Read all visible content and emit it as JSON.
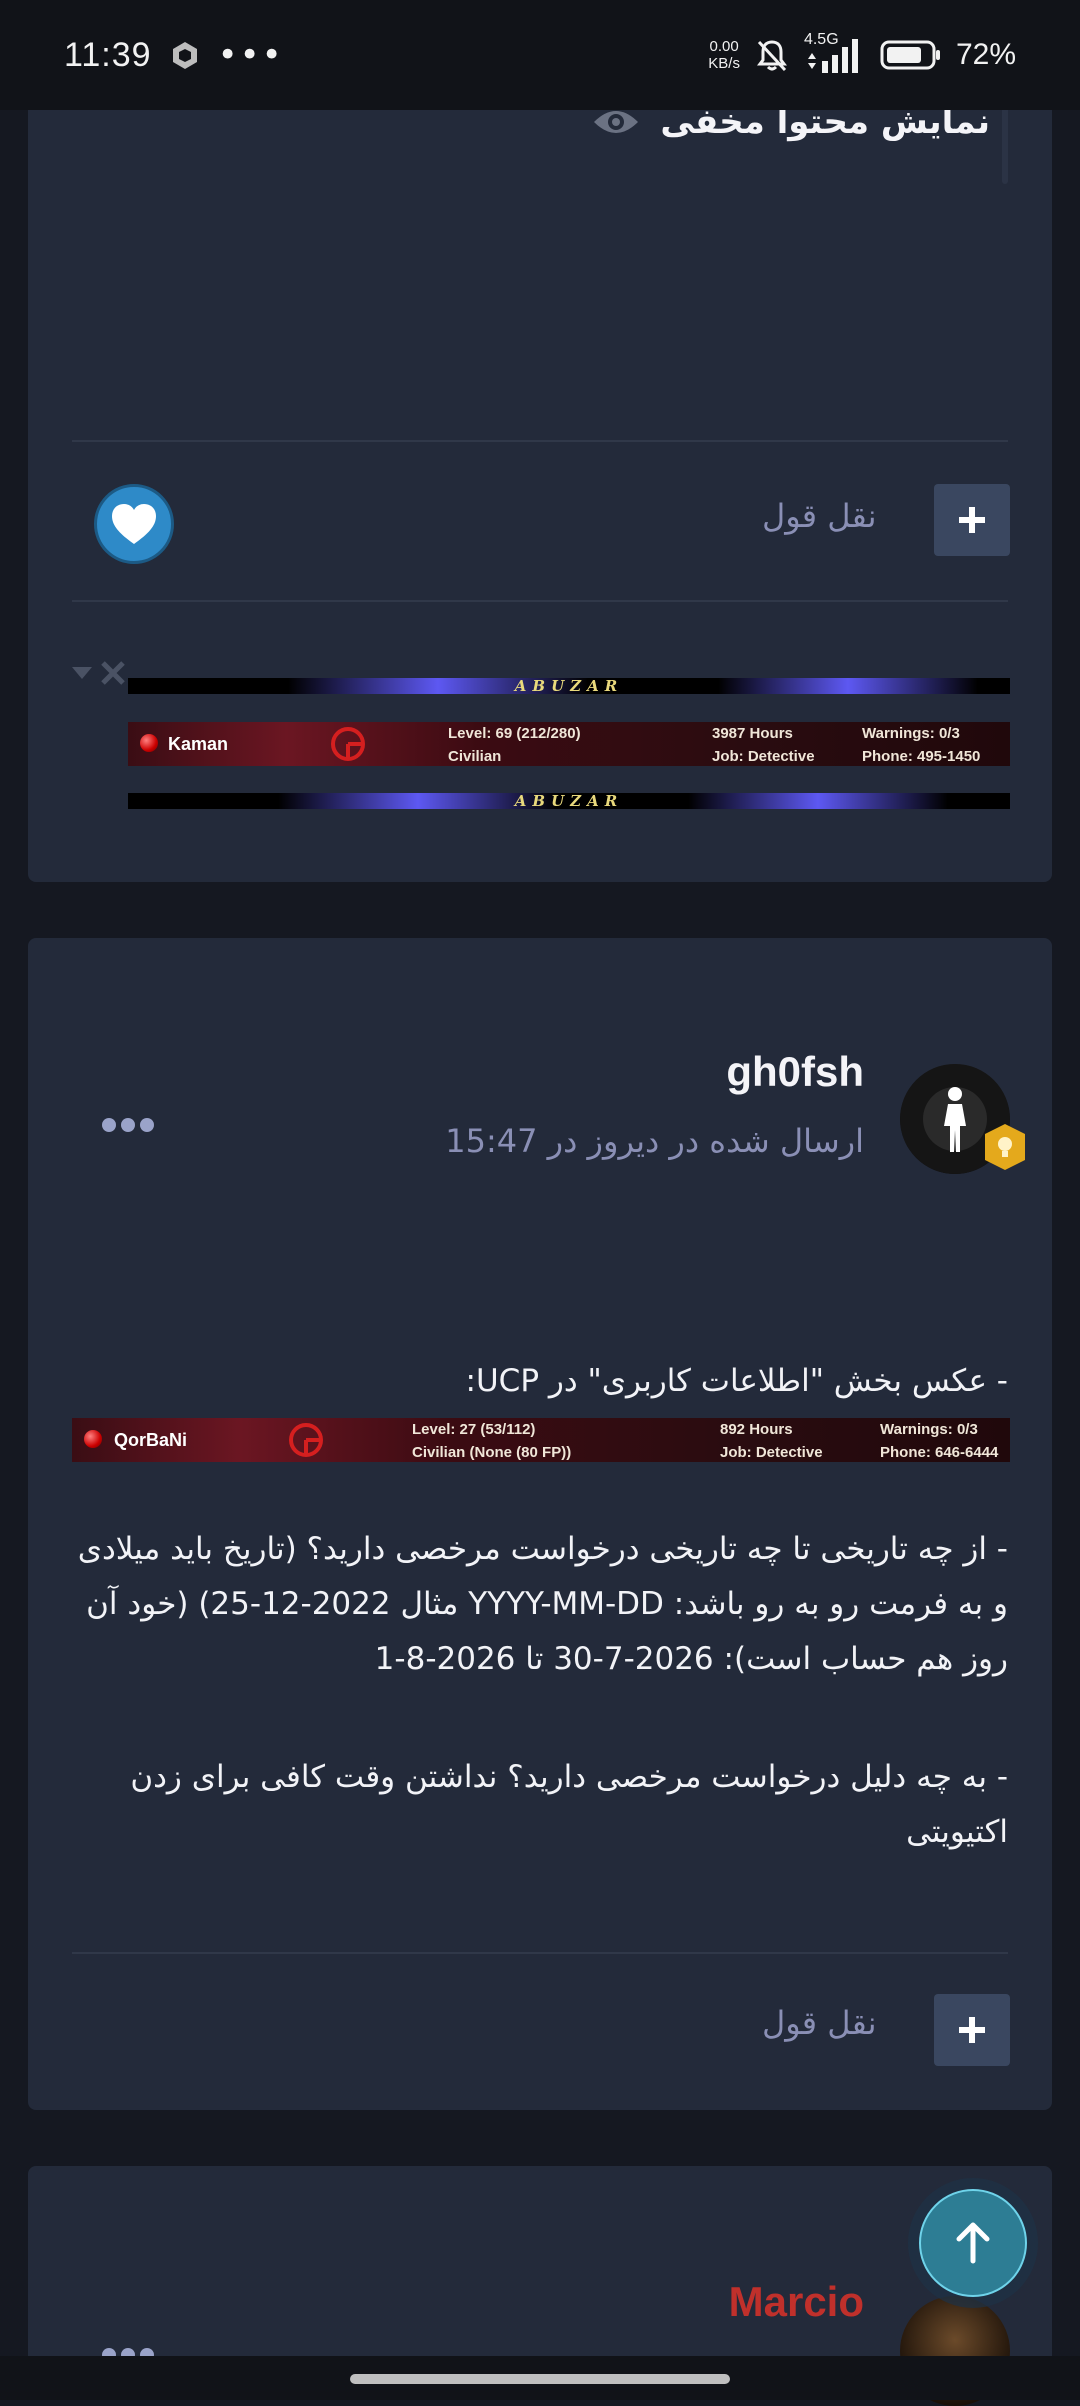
{
  "status_bar": {
    "time": "11:39",
    "dots": "•••",
    "net_speed_value": "0.00",
    "net_speed_unit": "KB/s",
    "signal_label": "4.5G",
    "battery": "72%"
  },
  "card1": {
    "hidden_content_label": "نمایش محتوا مخفی",
    "quote_label": "نقل قول",
    "signature": {
      "banner_text": "ABUZAR",
      "ucp_name": "Kaman",
      "level": "Level: 69 (212/280)",
      "class": "Civilian",
      "hours": "3987 Hours",
      "job": "Job: Detective",
      "warnings": "Warnings: 0/3",
      "phone": "Phone: 495-1450",
      "logo_text": "AMES\nRSACIA"
    }
  },
  "card2": {
    "author": "gh0fsh",
    "post_time": "ارسال شده در دیروز در 15:47",
    "intro_line": "- عکس بخش \"اطلاعات کاربری\" در UCP:",
    "ucp": {
      "name": "QorBaNi",
      "level": "Level: 27 (53/112)",
      "class": "Civilian (None (80 FP))",
      "hours": "892 Hours",
      "job": "Job: Detective",
      "warnings": "Warnings: 0/3",
      "phone": "Phone: 646-6444"
    },
    "question_dates": "- از چه تاریخی تا چه تاریخی درخواست مرخصی دارید؟ (تاریخ باید میلادی و به فرمت رو به رو باشد: YYYY-MM-DD مثال 2022-12-25) (خود آن روز هم حساب است): 2026-7-30 تا 2026-8-1",
    "question_reason": "- به چه دلیل درخواست مرخصی دارید؟ نداشتن وقت کافی برای زدن اکتیویتی",
    "quote_label": "نقل قول"
  },
  "card3": {
    "author": "Marcio"
  },
  "colors": {
    "accent_heart": "#2e8ac8",
    "author_red": "#c0302b",
    "meta_purple": "#8a8fb5"
  },
  "icons": [
    "eye-icon",
    "heart-icon",
    "plus-icon",
    "more-icon",
    "arrow-up-icon",
    "badge-icon",
    "close-icon",
    "caret-down-icon"
  ]
}
